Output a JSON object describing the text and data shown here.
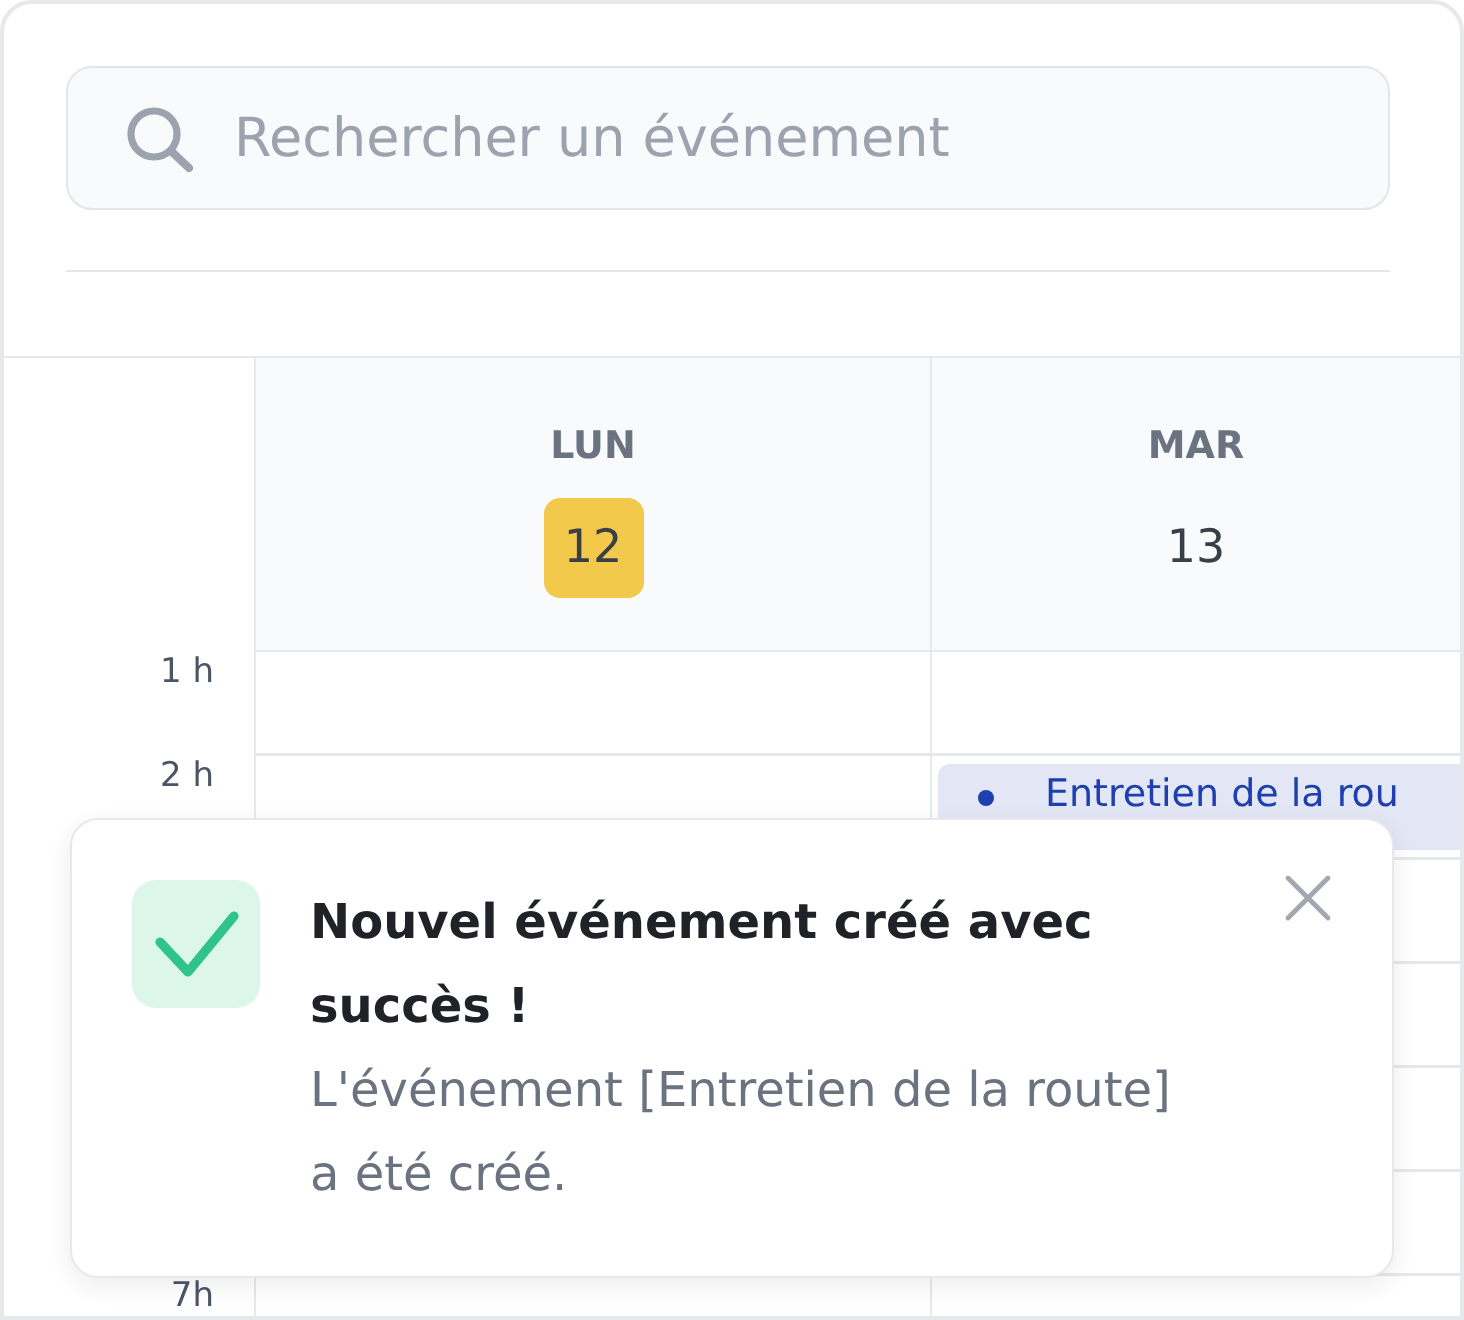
{
  "search": {
    "placeholder": "Rechercher un événement"
  },
  "calendar": {
    "days": [
      {
        "weekday": "LUN",
        "date": "12",
        "selected": true
      },
      {
        "weekday": "MAR",
        "date": "13",
        "selected": false
      }
    ],
    "time_slots": [
      {
        "label": "1 h"
      },
      {
        "label": "2 h",
        "cells": [
          {},
          {
            "events": [
              {
                "title": "Entretien de la rou",
                "color": "#1e40af"
              }
            ]
          }
        ]
      },
      {
        "label": "7h"
      }
    ]
  },
  "toast": {
    "kind": "success",
    "title": "Nouvel événement créé avec succès !",
    "message": "L'événement [Entretien de la route] a été créé."
  }
}
